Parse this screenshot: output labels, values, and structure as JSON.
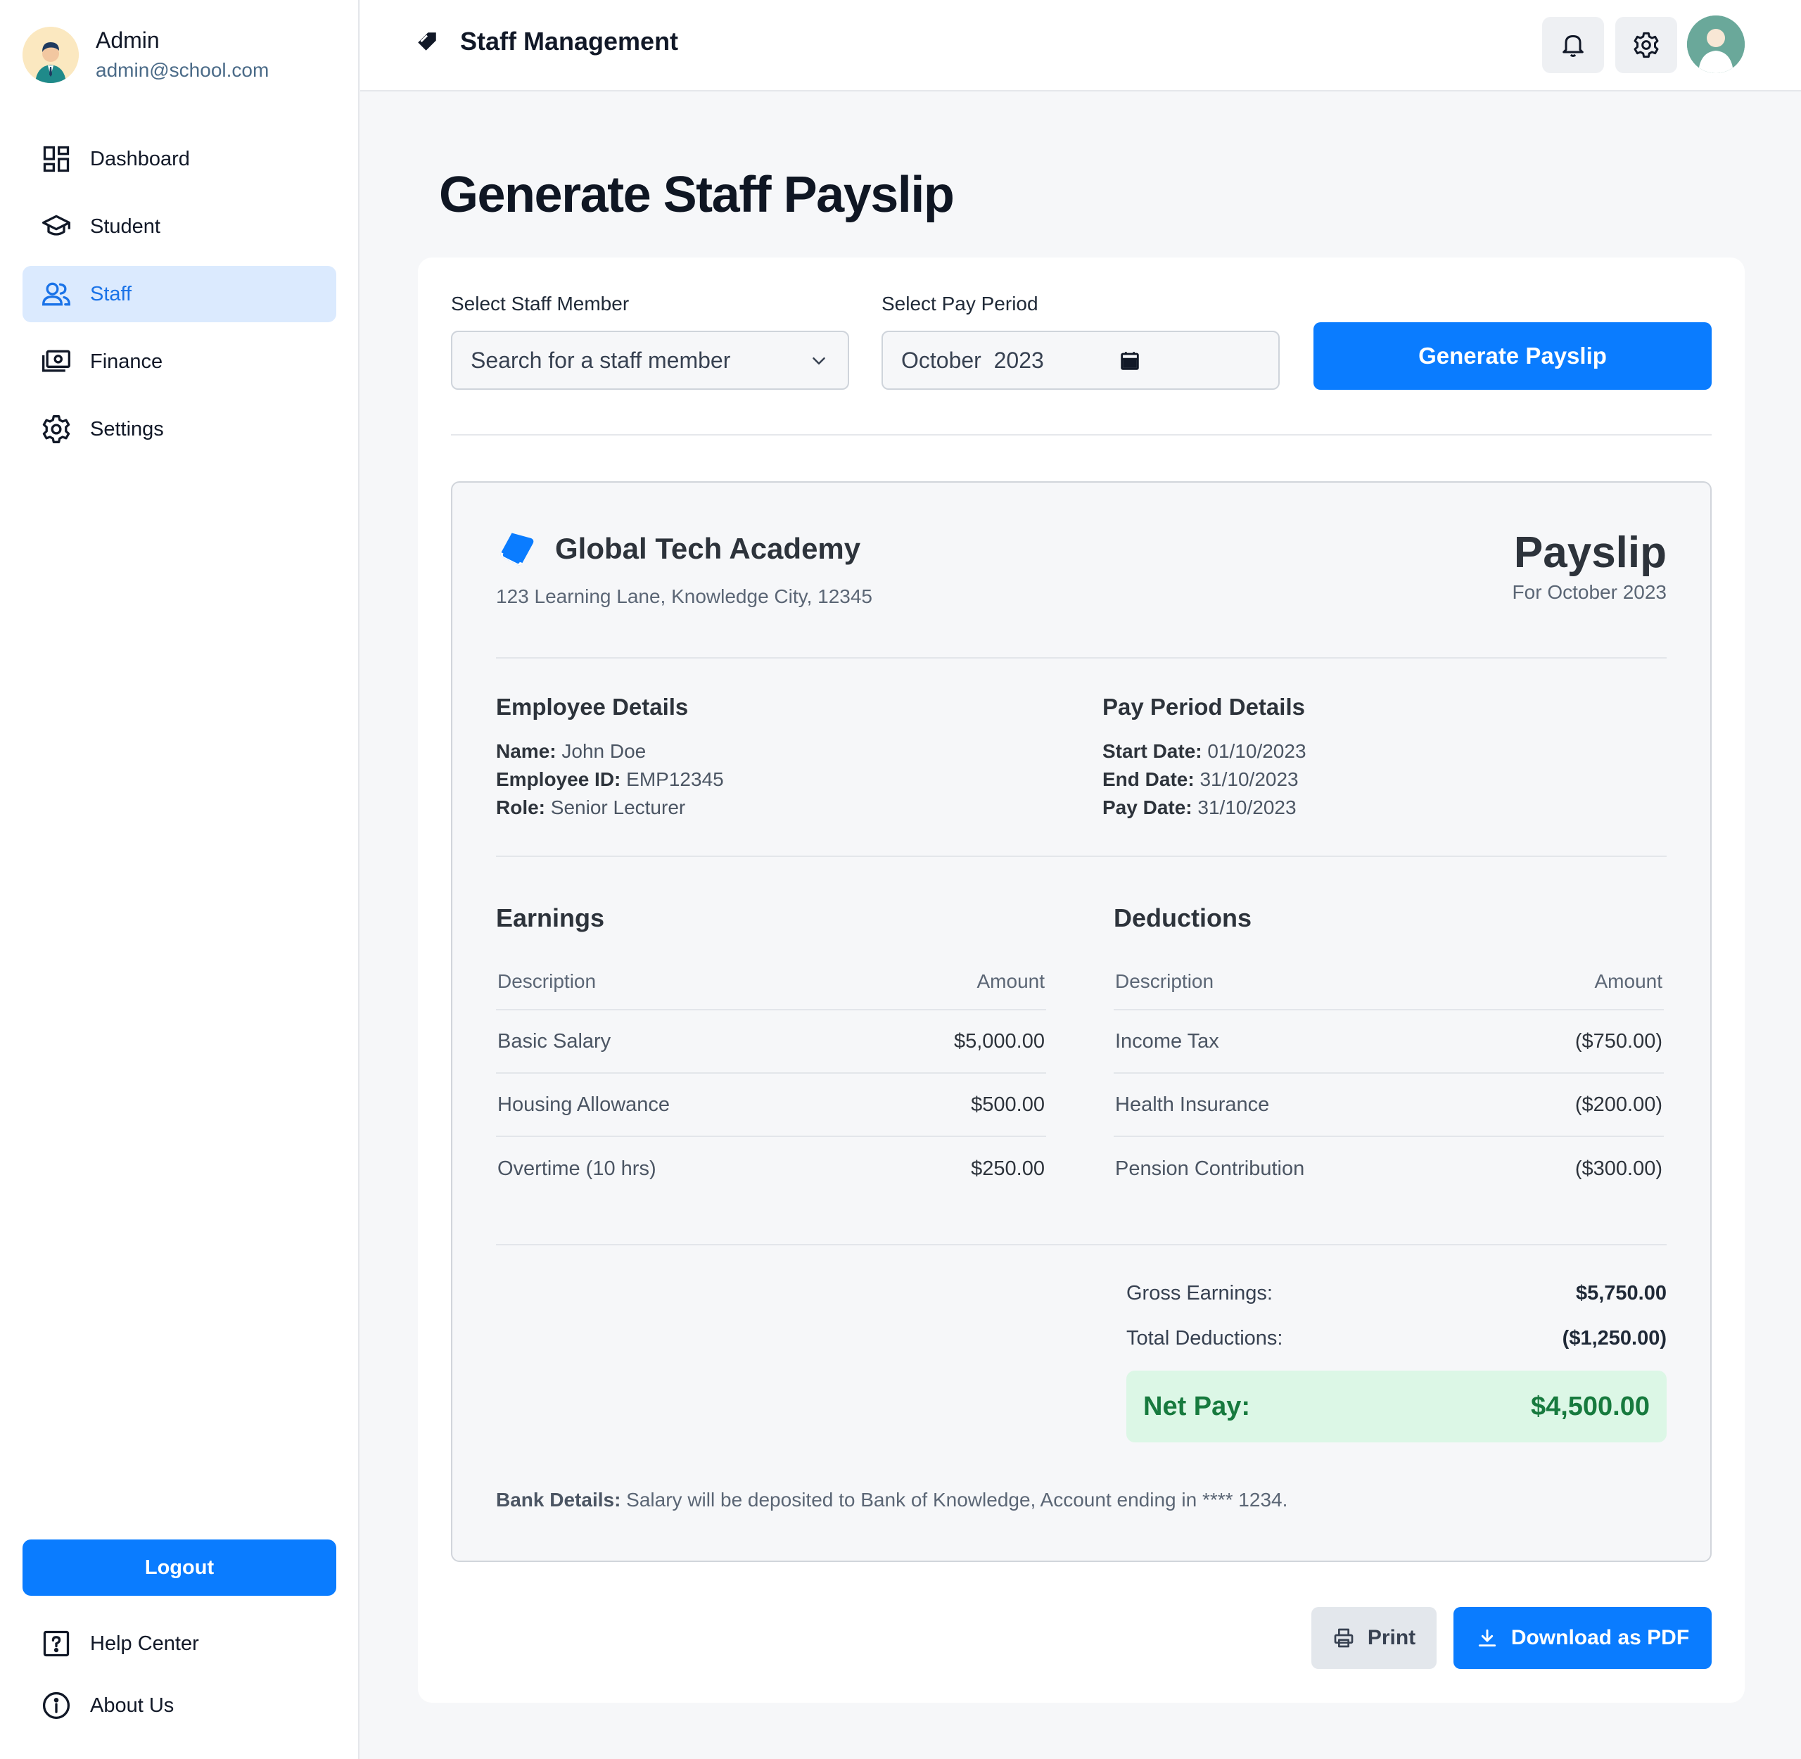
{
  "sidebar": {
    "user": {
      "name": "Admin",
      "email": "admin@school.com"
    },
    "items": [
      {
        "label": "Dashboard",
        "icon": "dashboard-icon"
      },
      {
        "label": "Student",
        "icon": "graduation-cap-icon"
      },
      {
        "label": "Staff",
        "icon": "users-icon",
        "active": true
      },
      {
        "label": "Finance",
        "icon": "money-icon"
      },
      {
        "label": "Settings",
        "icon": "gear-icon"
      }
    ],
    "logout_label": "Logout",
    "footer": [
      {
        "label": "Help Center",
        "icon": "help-icon"
      },
      {
        "label": "About Us",
        "icon": "info-icon"
      }
    ]
  },
  "header": {
    "title": "Staff Management"
  },
  "main": {
    "title": "Generate Staff Payslip",
    "form": {
      "staff_label": "Select Staff Member",
      "staff_placeholder": "Search for a staff member",
      "period_label": "Select Pay Period",
      "period_value": "October  2023",
      "generate_label": "Generate Payslip"
    },
    "payslip": {
      "school": "Global Tech Academy",
      "address": "123 Learning Lane, Knowledge City, 12345",
      "title": "Payslip",
      "for": "For October 2023",
      "employee": {
        "title": "Employee Details",
        "name_k": "Name:",
        "name_v": "John Doe",
        "id_k": "Employee ID:",
        "id_v": "EMP12345",
        "role_k": "Role:",
        "role_v": "Senior Lecturer"
      },
      "period": {
        "title": "Pay Period Details",
        "start_k": "Start Date:",
        "start_v": "01/10/2023",
        "end_k": "End Date:",
        "end_v": "31/10/2023",
        "pay_k": "Pay Date:",
        "pay_v": "31/10/2023"
      },
      "earnings": {
        "title": "Earnings",
        "col_desc": "Description",
        "col_amt": "Amount",
        "rows": [
          {
            "desc": "Basic Salary",
            "amt": "$5,000.00"
          },
          {
            "desc": "Housing Allowance",
            "amt": "$500.00"
          },
          {
            "desc": "Overtime (10 hrs)",
            "amt": "$250.00"
          }
        ]
      },
      "deductions": {
        "title": "Deductions",
        "col_desc": "Description",
        "col_amt": "Amount",
        "rows": [
          {
            "desc": "Income Tax",
            "amt": "($750.00)"
          },
          {
            "desc": "Health Insurance",
            "amt": "($200.00)"
          },
          {
            "desc": "Pension Contribution",
            "amt": "($300.00)"
          }
        ]
      },
      "summary": {
        "gross_label": "Gross Earnings:",
        "gross_value": "$5,750.00",
        "ded_label": "Total Deductions:",
        "ded_value": "($1,250.00)",
        "net_label": "Net Pay:",
        "net_value": "$4,500.00"
      },
      "bank_label": "Bank Details:",
      "bank_text": " Salary will be deposited to Bank of Knowledge, Account ending in **** 1234."
    },
    "actions": {
      "print_label": "Print",
      "pdf_label": "Download as PDF"
    }
  },
  "colors": {
    "primary": "#0a7cff",
    "active_bg": "#dbeafe",
    "net_bg": "#dcf7e6",
    "net_text": "#177a3e"
  }
}
